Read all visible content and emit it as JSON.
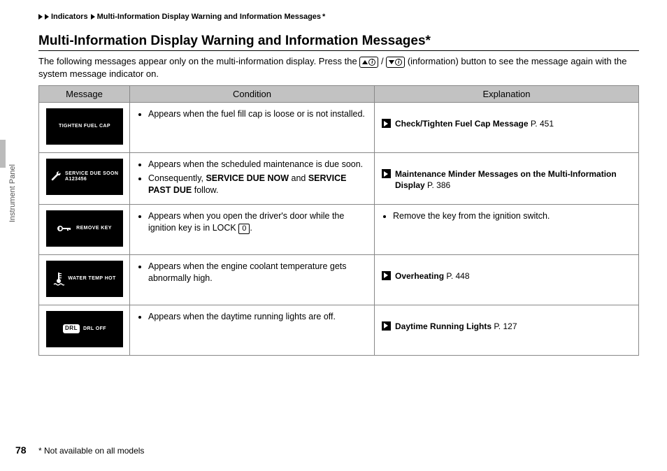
{
  "breadcrumb": {
    "seg1": "Indicators",
    "seg2": "Multi-Information Display Warning and Information Messages",
    "asterisk": "*"
  },
  "heading": "Multi-Information Display Warning and Information Messages",
  "heading_asterisk": "*",
  "intro_a": "The following messages appear only on the multi-information display. Press the ",
  "intro_b": " / ",
  "intro_c": " (information) button to see the message again with the system message indicator on.",
  "headers": {
    "c1": "Message",
    "c2": "Condition",
    "c3": "Explanation"
  },
  "rows": [
    {
      "icon_label": "TIGHTEN FUEL CAP",
      "conditions": [
        {
          "text": "Appears when the fuel fill cap is loose or is not installed."
        }
      ],
      "explanation": {
        "type": "xref",
        "title": "Check/Tighten Fuel Cap Message",
        "page": "P. 451"
      }
    },
    {
      "icon_label": "SERVICE DUE SOON A123456",
      "conditions": [
        {
          "text": "Appears when the scheduled maintenance is due soon."
        },
        {
          "pre": "Consequently, ",
          "b1": "SERVICE DUE NOW",
          "mid": " and ",
          "b2": "SERVICE PAST DUE",
          "post": " follow."
        }
      ],
      "explanation": {
        "type": "xref",
        "title": "Maintenance Minder Messages on the Multi-Information Display",
        "page": "P. 386"
      }
    },
    {
      "icon_label": "REMOVE KEY",
      "conditions": [
        {
          "pre": "Appears when you open the driver's door while the ignition key is in LOCK ",
          "box": "0",
          "post": "."
        }
      ],
      "explanation": {
        "type": "bullet",
        "text": "Remove the key from the ignition switch."
      }
    },
    {
      "icon_label": "WATER TEMP HOT",
      "conditions": [
        {
          "text": "Appears when the engine coolant temperature gets abnormally high."
        }
      ],
      "explanation": {
        "type": "xref",
        "title": "Overheating",
        "page": "P. 448"
      }
    },
    {
      "icon_label": "DRL OFF",
      "conditions": [
        {
          "text": "Appears when the daytime running lights are off."
        }
      ],
      "explanation": {
        "type": "xref",
        "title": "Daytime Running Lights",
        "page": "P. 127"
      }
    }
  ],
  "side_label": "Instrument Panel",
  "page_number": "78",
  "footnote": "* Not available on all models"
}
